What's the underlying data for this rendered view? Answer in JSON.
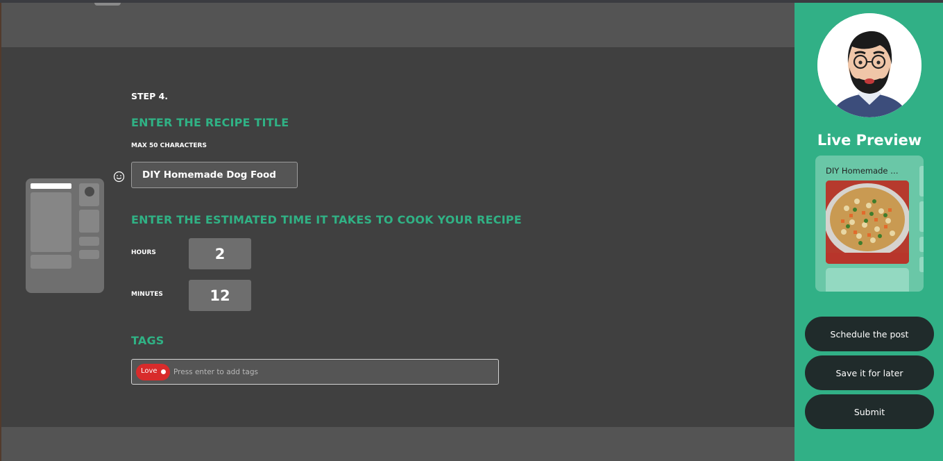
{
  "form": {
    "step": "STEP 4.",
    "title_heading": "ENTER THE RECIPE TITLE",
    "max_chars": "MAX 50 CHARACTERS",
    "title_value": "DIY Homemade Dog Food",
    "time_heading": "ENTER THE ESTIMATED TIME IT TAKES TO COOK YOUR RECIPE",
    "hours_label": "HOURS",
    "hours_value": "2",
    "minutes_label": "MINUTES",
    "minutes_value": "12",
    "tags_heading": "TAGS",
    "tags": [
      "Love"
    ],
    "tags_placeholder": "Press enter to add tags"
  },
  "sidebar": {
    "preview_title": "Live Preview",
    "card_title": "DIY Homemade Do...",
    "buttons": {
      "schedule": "Schedule the post",
      "save": "Save it for later",
      "submit": "Submit"
    }
  },
  "colors": {
    "accent_green": "#30b285",
    "sidebar_green": "#31b086",
    "panel_dark": "#404040",
    "tag_red": "#d82b2b",
    "button_dark": "#202b2b"
  },
  "icons": [
    "smiley-icon",
    "phone-layout-illustration",
    "remove-tag-icon",
    "avatar"
  ]
}
